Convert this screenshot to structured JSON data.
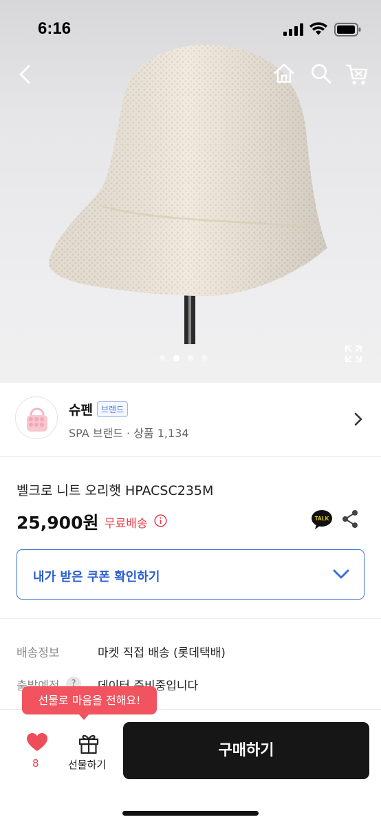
{
  "status_bar": {
    "time": "6:16"
  },
  "product_image": {
    "alt": "knit ivory cap",
    "dots_total": 4,
    "active_dot": 2
  },
  "icons": {
    "back": "chevron-left-icon",
    "home": "home-icon",
    "search": "search-icon",
    "cart": "cart-icon",
    "expand": "expand-icon",
    "info": "info-icon",
    "kakao": "kakao-talk-icon",
    "share": "share-icon",
    "heart": "heart-icon",
    "gift": "gift-icon"
  },
  "brand": {
    "name": "슈펜",
    "badge": "브랜드",
    "subtitle": "SPA 브랜드 · 상품 1,134"
  },
  "product": {
    "title": "벨크로 니트 오리햇  HPACSC235M",
    "price": "25,900원",
    "shipping_label": "무료배송",
    "talk_badge": "TALK"
  },
  "coupon": {
    "label": "내가 받은 쿠폰 확인하기"
  },
  "details": [
    {
      "label": "배송정보",
      "value": "마켓 직접 배송 (롯데택배)"
    },
    {
      "label": "출발예정",
      "value": "데이터 준비중입니다",
      "help": "?"
    }
  ],
  "bottom_bar": {
    "tooltip": "선물로 마음을 전해요!",
    "like_count": "8",
    "gift_label": "선물하기",
    "buy_label": "구매하기"
  },
  "colors": {
    "accent_blue": "#3b6fd6",
    "accent_red": "#e8424f",
    "buy_button": "#161616"
  }
}
